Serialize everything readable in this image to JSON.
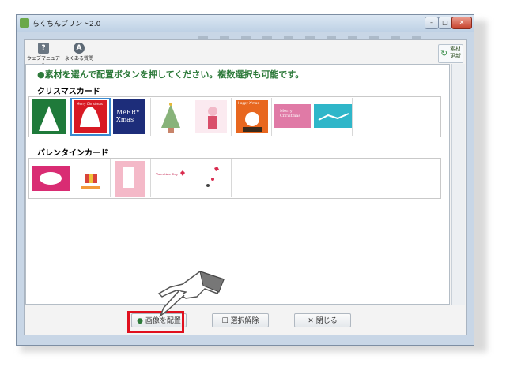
{
  "window": {
    "title": "らくちんプリント2.0"
  },
  "toolbar": {
    "manual_label": "ウェブマニュアル",
    "faq_label": "よくある質問",
    "refresh_label_1": "素材",
    "refresh_label_2": "更新"
  },
  "instruction": "●素材を選んで配置ボタンを押してください。複数選択も可能です。",
  "sections": [
    {
      "title": "クリスマスカード",
      "count": 8,
      "selected_index": 1
    },
    {
      "title": "バレンタインカード",
      "count": 5
    }
  ],
  "thumb_text": {
    "mc": "Merry Christmas",
    "mx1": "MeRRY",
    "mx2": "Xmas",
    "hx": "Happy X'mas",
    "vday": "Valentine Day"
  },
  "buttons": {
    "place": "画像を配置",
    "clear": "選択解除",
    "close": "閉じる"
  },
  "icons": {
    "place": "●",
    "clear": "☐",
    "close": "✕",
    "refresh": "↻"
  }
}
